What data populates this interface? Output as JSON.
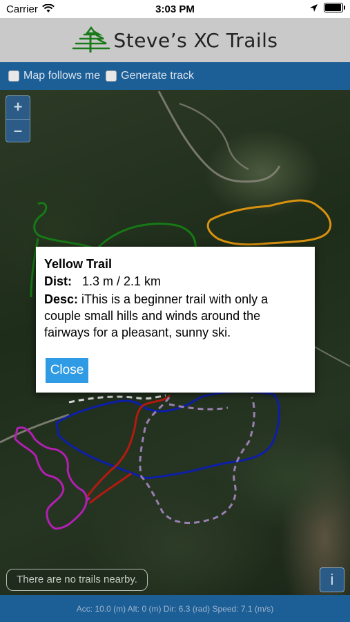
{
  "status_bar": {
    "carrier": "Carrier",
    "time": "3:03 PM",
    "battery_level": 0.9
  },
  "header": {
    "title": "Steve’s XC Trails",
    "logo_icon": "pine-tree-icon"
  },
  "toolbar": {
    "map_follows_label": "Map follows me",
    "map_follows_checked": false,
    "generate_track_label": "Generate track",
    "generate_track_checked": false
  },
  "map": {
    "zoom_in_label": "+",
    "zoom_out_label": "–",
    "trail_colors": {
      "orange": "#d9920f",
      "green": "#167a16",
      "blue": "#0d1fa8",
      "red": "#b41a10",
      "purple": "#b21fb2",
      "lavender": "#9a80b2",
      "white": "#d8d8d8"
    }
  },
  "popup": {
    "title": "Yellow Trail",
    "dist_label": "Dist:",
    "dist_value": "1.3 m / 2.1 km",
    "desc_label": "Desc:",
    "desc_value": "iThis is a beginner trail with only a couple small hills and winds around the fairways for a pleasant, sunny ski.",
    "close_label": "Close"
  },
  "nearby_message": "There are no trails nearby.",
  "info_button_label": "i",
  "footer": {
    "sensor_readout": "Acc: 10.0 (m) Alt: 0 (m) Dir: 6.3 (rad) Speed: 7.1 (m/s)"
  }
}
